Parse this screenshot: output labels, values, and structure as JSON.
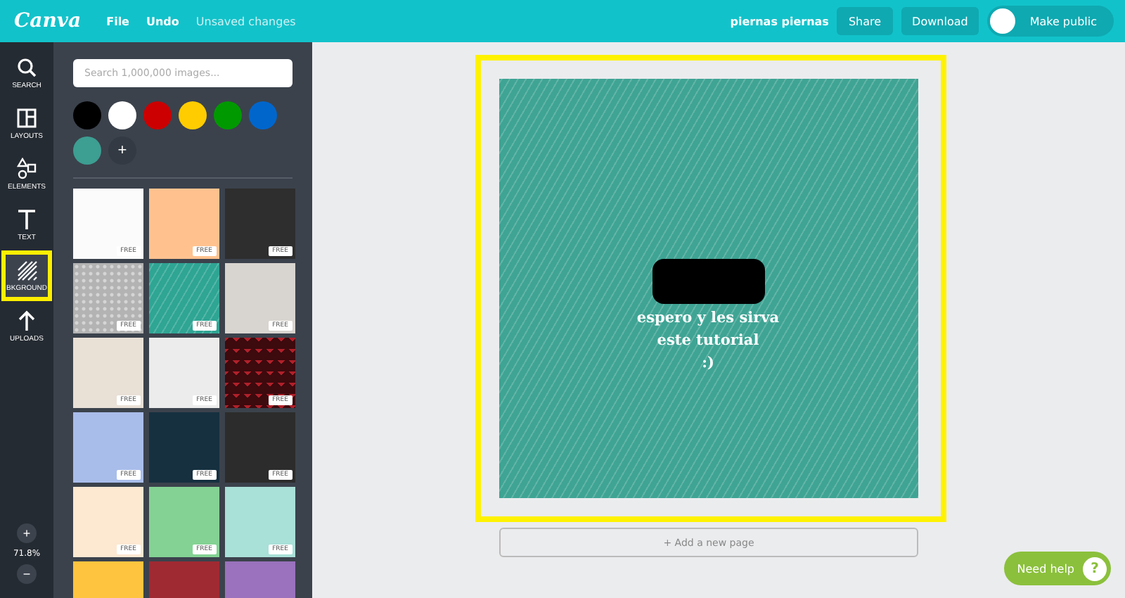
{
  "topbar": {
    "logo": "Canva",
    "menu": [
      "File",
      "Undo"
    ],
    "status": "Unsaved changes",
    "user": "piernas piernas",
    "buttons": [
      "Share",
      "Download"
    ],
    "public_toggle": {
      "label": "Make public",
      "on": false
    }
  },
  "rail": {
    "items": [
      {
        "label": "SEARCH",
        "selected": false,
        "highlighted": false
      },
      {
        "label": "LAYOUTS",
        "selected": false,
        "highlighted": false
      },
      {
        "label": "ELEMENTS",
        "selected": false,
        "highlighted": false
      },
      {
        "label": "TEXT",
        "selected": false,
        "highlighted": false
      },
      {
        "label": "BKGROUND",
        "selected": true,
        "highlighted": true
      },
      {
        "label": "UPLOADS",
        "selected": false,
        "highlighted": false
      }
    ],
    "zoom": {
      "in": "+",
      "level": "71.8%",
      "out": "−"
    }
  },
  "panel": {
    "search": {
      "placeholder": "Search 1,000,000 images..."
    },
    "swatches": [
      {
        "color": "#000000"
      },
      {
        "color": "#ffffff"
      },
      {
        "color": "#cc0000"
      },
      {
        "color": "#ffcc00"
      },
      {
        "color": "#009900"
      },
      {
        "color": "#0066cc"
      },
      {
        "color": "#3d9e92"
      }
    ],
    "add_swatch": "+",
    "backgrounds": [
      {
        "color": "#fbfbfb",
        "kind": "plain",
        "badge": "FREE"
      },
      {
        "color": "#ffc28f",
        "kind": "plain",
        "badge": "FREE"
      },
      {
        "color": "#2e2e2e",
        "kind": "plain",
        "badge": "FREE"
      },
      {
        "color": "#b3b3b3",
        "kind": "dots",
        "badge": "FREE"
      },
      {
        "color": "#2fa594",
        "kind": "stripes",
        "badge": "FREE"
      },
      {
        "color": "#d8d4cf",
        "kind": "plain",
        "badge": "FREE"
      },
      {
        "color": "#e9e0d6",
        "kind": "plain",
        "badge": "FREE"
      },
      {
        "color": "#ececec",
        "kind": "plain",
        "badge": "FREE"
      },
      {
        "color": "#3d0a0e",
        "kind": "chevron",
        "badge": "FREE"
      },
      {
        "color": "#a9bdea",
        "kind": "plain",
        "badge": "FREE"
      },
      {
        "color": "#163040",
        "kind": "plain",
        "badge": "FREE"
      },
      {
        "color": "#2c2c2c",
        "kind": "plain",
        "badge": "FREE"
      },
      {
        "color": "#fde8d2",
        "kind": "plain",
        "badge": "FREE"
      },
      {
        "color": "#84d294",
        "kind": "plain",
        "badge": "FREE"
      },
      {
        "color": "#a9e0d8",
        "kind": "plain",
        "badge": "FREE"
      },
      {
        "color": "#ffc43f",
        "kind": "plain"
      },
      {
        "color": "#a02a32",
        "kind": "plain"
      },
      {
        "color": "#9a72bd",
        "kind": "plain"
      }
    ]
  },
  "design": {
    "highlighted": true,
    "background": {
      "color": "#3fa494",
      "kind": "stripes"
    },
    "elements": [
      {
        "kind": "redaction"
      },
      {
        "kind": "text",
        "text": "espero y les sirva\neste tutorial\n:)"
      }
    ]
  },
  "add_page": "+ Add a new page",
  "help": {
    "label": "Need help",
    "icon": "?"
  }
}
